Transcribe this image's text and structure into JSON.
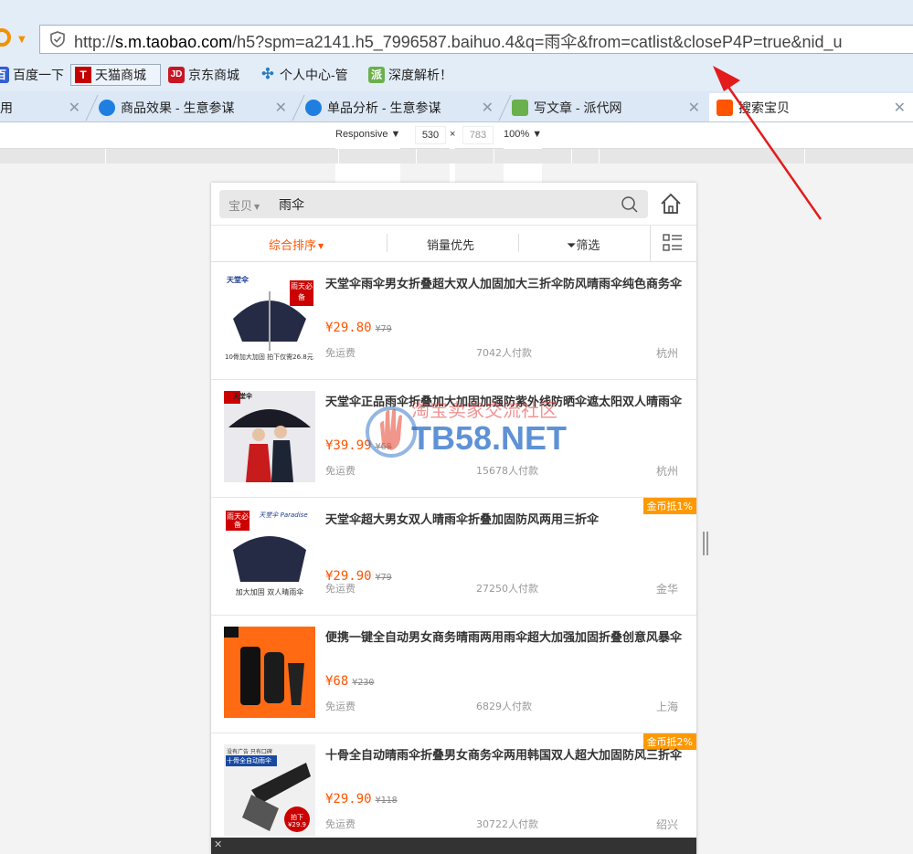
{
  "browser": {
    "url_scheme": "http://",
    "url_host": "s.m.taobao.com",
    "url_rest": "/h5?spm=a2141.h5_7996587.baihuo.4&q=雨伞&from=catlist&closeP4P=true&nid_u",
    "bookmarks": [
      {
        "label": "百度一下",
        "icon": "baidu-icon",
        "color": "#3060d0"
      },
      {
        "label": "天猫商城",
        "icon": "tmall-icon",
        "color": "#c40000"
      },
      {
        "label": "京东商城",
        "icon": "jd-icon",
        "color": "#c81623"
      },
      {
        "label": "个人中心-管",
        "icon": "joomla-icon",
        "color": "#2b7bc0"
      },
      {
        "label": "深度解析！",
        "icon": "paidai-icon",
        "color": "#6ab04c"
      }
    ],
    "tabs": [
      {
        "label": "用",
        "icon": "",
        "color": ""
      },
      {
        "label": "商品效果 - 生意参谋",
        "icon": "compass-icon",
        "color": "#1e7fe0"
      },
      {
        "label": "单品分析 - 生意参谋",
        "icon": "compass-icon",
        "color": "#1e7fe0"
      },
      {
        "label": "写文章 - 派代网",
        "icon": "paidai-icon",
        "color": "#6ab04c"
      },
      {
        "label": "搜索宝贝",
        "icon": "taobao-icon",
        "color": "#ff5500"
      }
    ],
    "devtools": {
      "device": "Responsive",
      "width": "530",
      "times": "×",
      "height": "783",
      "zoom": "100%"
    }
  },
  "search": {
    "category": "宝贝",
    "query": "雨伞"
  },
  "sort": {
    "comprehensive": "综合排序",
    "sales": "销量优先",
    "filter": "筛选"
  },
  "colors": {
    "accent": "#ff5500",
    "badge": "#ff9900"
  },
  "products": [
    {
      "title": "天堂伞雨伞男女折叠超大双人加固加大三折伞防风晴雨伞纯色商务伞",
      "price": "¥29.80",
      "orig": "¥79",
      "ship": "免运费",
      "paid": "7042人付款",
      "loc": "杭州",
      "badge": "",
      "thumb": "navy",
      "thumb_brand": "天堂伞",
      "thumb_tag": "雨天必备",
      "thumb_caption": "10骨加大加固 拍下仅需26.8元"
    },
    {
      "title": "天堂伞正品雨伞折叠加大加固加强防紫外线防晒伞遮太阳双人晴雨伞",
      "price": "¥39.99",
      "orig": "¥68",
      "ship": "免运费",
      "paid": "15678人付款",
      "loc": "杭州",
      "badge": "",
      "thumb": "couple",
      "thumb_brand": "天堂伞",
      "thumb_tag": "",
      "thumb_caption": ""
    },
    {
      "title": "天堂伞超大男女双人晴雨伞折叠加固防风两用三折伞",
      "price": "¥29.90",
      "orig": "¥79",
      "ship": "免运费",
      "paid": "27250人付款",
      "loc": "金华",
      "badge": "金币抵1%",
      "thumb": "navy2",
      "thumb_brand": "天堂伞 Paradise",
      "thumb_tag": "雨天必备",
      "thumb_caption": "加大加固 双人晴雨伞"
    },
    {
      "title": "便携一键全自动男女商务晴雨两用雨伞超大加强加固折叠创意风暴伞",
      "price": "¥68",
      "orig": "¥230",
      "ship": "免运费",
      "paid": "6829人付款",
      "loc": "上海",
      "badge": "",
      "thumb": "orange",
      "thumb_brand": "",
      "thumb_tag": "",
      "thumb_caption": ""
    },
    {
      "title": "十骨全自动晴雨伞折叠男女商务伞两用韩国双人超大加固防风三折伞",
      "price": "¥29.90",
      "orig": "¥118",
      "ship": "免运费",
      "paid": "30722人付款",
      "loc": "绍兴",
      "badge": "金币抵2%",
      "thumb": "auto",
      "thumb_brand": "没有广告 只有口碑",
      "thumb_tag": "十骨全自动雨伞",
      "thumb_caption": "拍下 ¥29.9"
    }
  ],
  "watermark": {
    "cn": "淘宝卖家交流社区",
    "en": "TB58.NET"
  }
}
